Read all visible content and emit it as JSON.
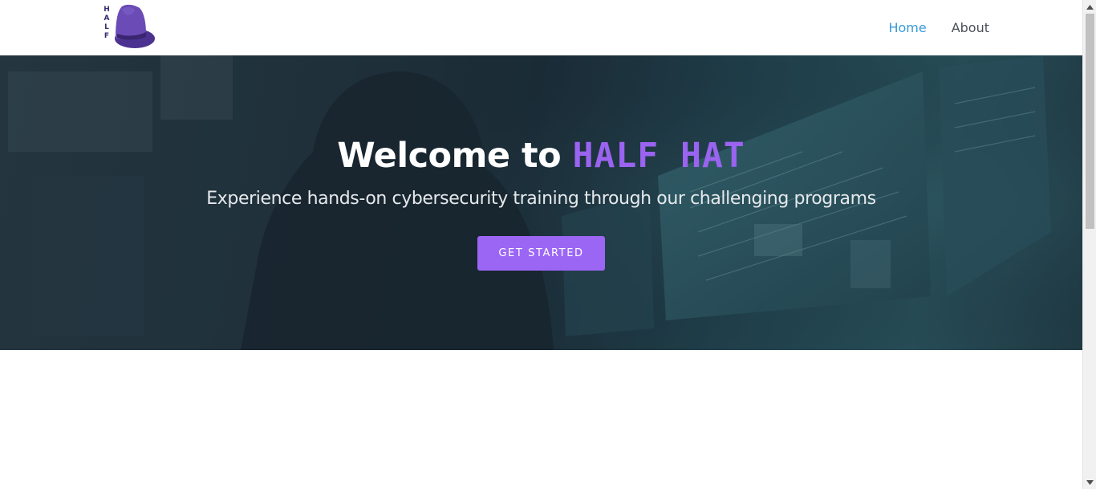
{
  "header": {
    "logo_letters": [
      "H",
      "A",
      "L",
      "F"
    ],
    "nav": [
      {
        "label": "Home",
        "active": true
      },
      {
        "label": "About",
        "active": false
      }
    ]
  },
  "hero": {
    "title_prefix": "Welcome to",
    "title_brand": "HALF HAT",
    "subtitle": "Experience hands-on cybersecurity training through our challenging programs",
    "cta_label": "GET STARTED"
  },
  "colors": {
    "brand_purple": "#9c66f5",
    "nav_active": "#3a9ad9",
    "nav_default": "#4a4f57"
  },
  "icons": {
    "logo": "purple-fedora-hat-icon",
    "scroll_up": "arrow-up-icon",
    "scroll_down": "arrow-down-icon"
  }
}
